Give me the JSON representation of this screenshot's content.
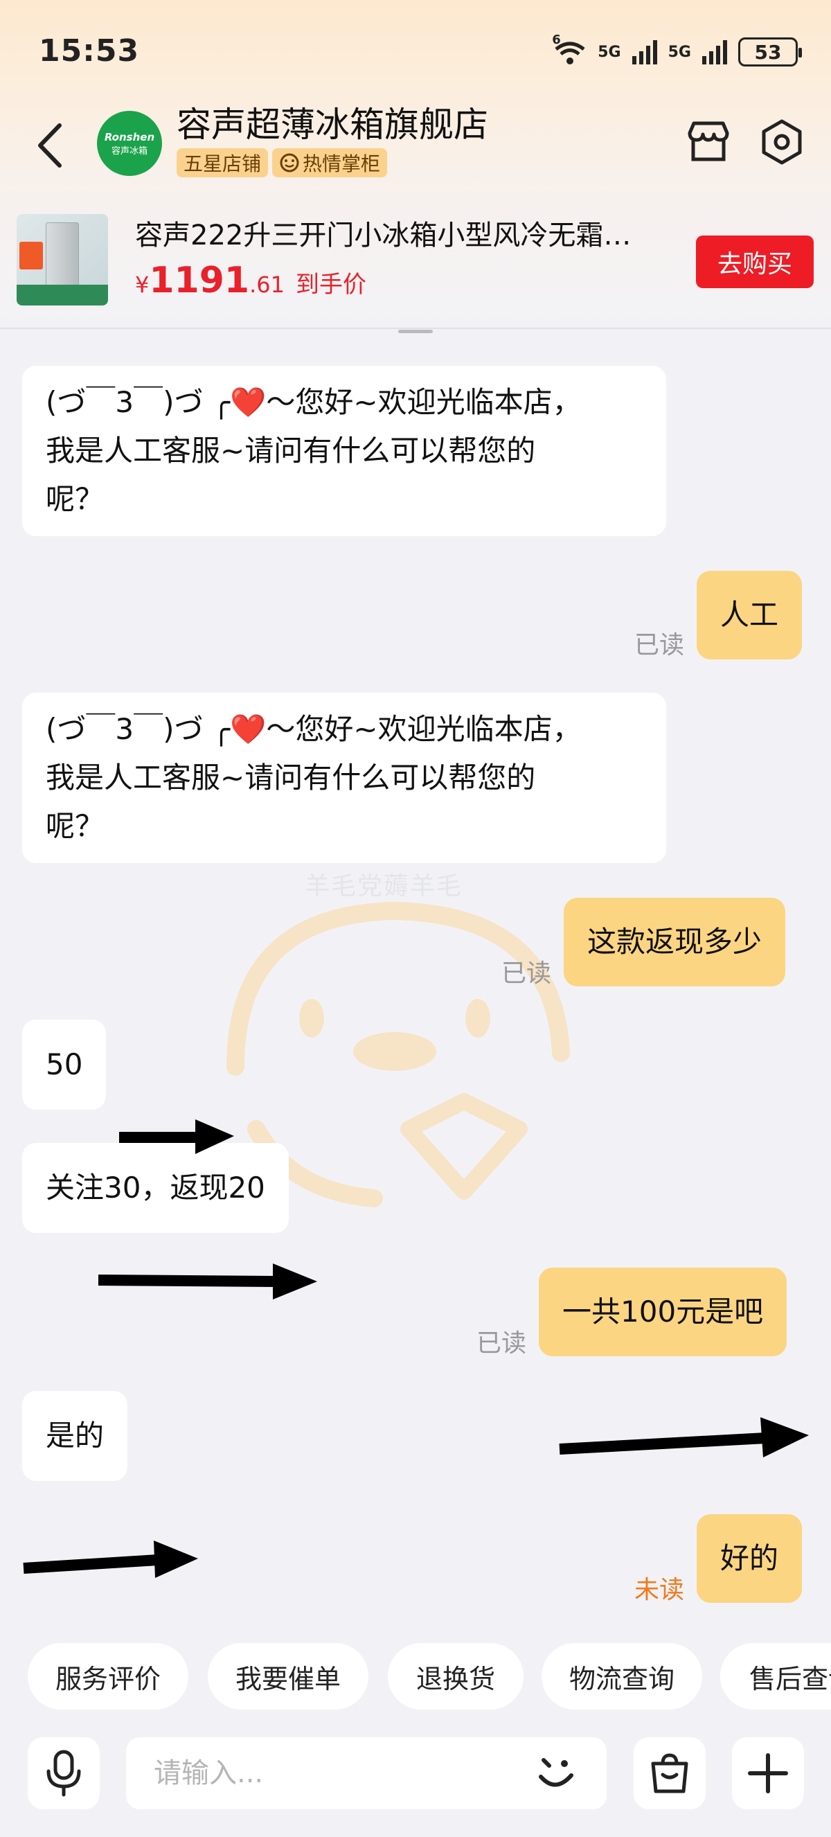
{
  "status_bar": {
    "time": "15:53",
    "wifi_label": "6",
    "net1_label": "5G",
    "net2_label": "5G",
    "battery": "53"
  },
  "header": {
    "shop_name": "容声超薄冰箱旗舰店",
    "logo_en": "Ronshen",
    "logo_cn": "容声冰箱",
    "badge_star": "五星店铺",
    "badge_host": "热情掌柜"
  },
  "product": {
    "title": "容声222升三开门小冰箱小型风冷无霜…",
    "price_currency": "¥",
    "price_int": "1191",
    "price_dec": ".61",
    "price_note": "到手价",
    "buy_label": "去购买"
  },
  "watermark": "羊毛党薅羊毛",
  "messages": [
    {
      "from": "shop",
      "lines": [
        "(づ￣3￣)づ ╭❤️～您好~欢迎光临本店，",
        "我是人工客服~请问有什么可以帮您的",
        "呢？"
      ]
    },
    {
      "from": "me",
      "text": "人工",
      "status": "已读"
    },
    {
      "from": "shop",
      "lines": [
        "(づ￣3￣)づ ╭❤️～您好~欢迎光临本店，",
        "我是人工客服~请问有什么可以帮您的",
        "呢？"
      ]
    },
    {
      "from": "me",
      "text": "这款返现多少",
      "status": "已读"
    },
    {
      "from": "shop",
      "text": "50"
    },
    {
      "from": "shop",
      "text": "关注30，返现20"
    },
    {
      "from": "me",
      "text": "一共100元是吧",
      "status": "已读"
    },
    {
      "from": "shop",
      "text": "是的"
    },
    {
      "from": "me",
      "text": "好的",
      "status": "未读"
    }
  ],
  "quick_actions": [
    "服务评价",
    "我要催单",
    "退换货",
    "物流查询",
    "售后查询"
  ],
  "input": {
    "placeholder": "请输入..."
  },
  "colors": {
    "accent_red": "#ee1c25",
    "outgoing_bubble": "#fbd582",
    "badge_bg": "#fbd28d",
    "unread": "#f07a1c",
    "logo_green": "#1aa34a"
  },
  "icons": [
    "back-arrow-icon",
    "store-icon",
    "settings-icon",
    "microphone-icon",
    "emoji-icon",
    "shopping-bag-icon",
    "plus-icon",
    "arrow-annotation"
  ]
}
